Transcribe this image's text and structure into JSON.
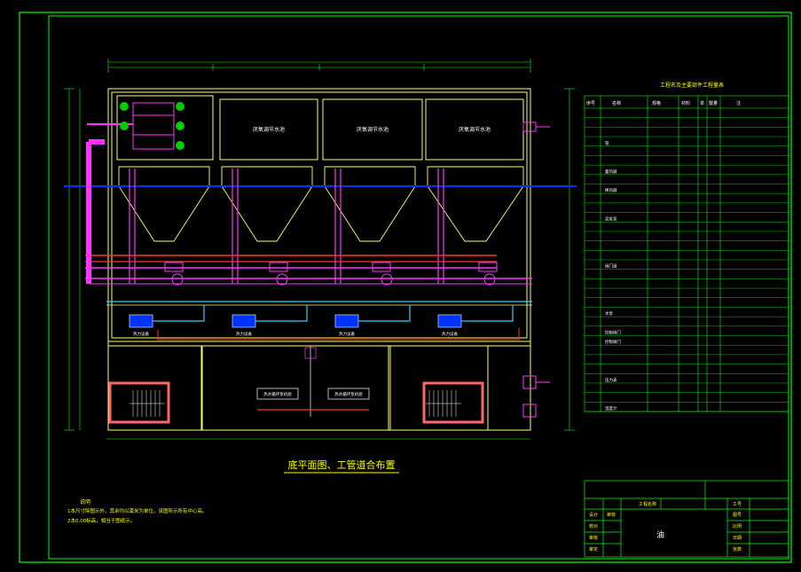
{
  "drawing": {
    "title": "底平面图、工管道合布置",
    "table_title": "工程名及主要部件工程量表",
    "table_headers": [
      "序号",
      "名称",
      "规格",
      "材料",
      "单",
      "数量",
      "注"
    ],
    "table_row_labels": [
      "",
      "",
      "",
      "管",
      "",
      "",
      "蓄热器",
      "",
      "换热器",
      "",
      "",
      "泥浆泵",
      "",
      "",
      "",
      "",
      "阀门组",
      "",
      "",
      "",
      "",
      "水泵",
      "",
      "控制阀门",
      "控制阀门",
      "",
      "",
      "",
      "压力表",
      "",
      "",
      "温度计"
    ],
    "tank_labels": [
      "厌氧调节水池",
      "厌氧调节水池",
      "厌氧调节水池"
    ],
    "equip_labels": [
      "热力设备",
      "热力设备",
      "热力设备",
      "热力设备"
    ],
    "pump_labels": [
      "热水循环泵机组",
      "热水循环泵机组"
    ],
    "notes": {
      "heading": "说明",
      "line1": "1本尺寸除图示外，其余均以毫米为单位，该图所示所有中心高。",
      "line2": "2本0.00标高，相当于图纸示。"
    },
    "title_block": {
      "row1": [
        "",
        "",
        "工程名称",
        "",
        "工号"
      ],
      "row2": [
        "设计",
        "审核",
        "",
        "",
        "图号"
      ],
      "rows_left": [
        "校对",
        "审核",
        "审定",
        "会签"
      ],
      "rows_right": [
        "比例",
        "日期",
        "张数"
      ],
      "name": "油"
    }
  },
  "colors": {
    "background": "#000000",
    "frame": "#00ff00",
    "wall": "#ffff66",
    "pipe_magenta": "#ff33ff",
    "pipe_red": "#ff3333",
    "pipe_blue": "#0033ff",
    "pipe_cyan": "#33ccff",
    "text": "#ffff00",
    "green_valve": "#00cc00"
  }
}
